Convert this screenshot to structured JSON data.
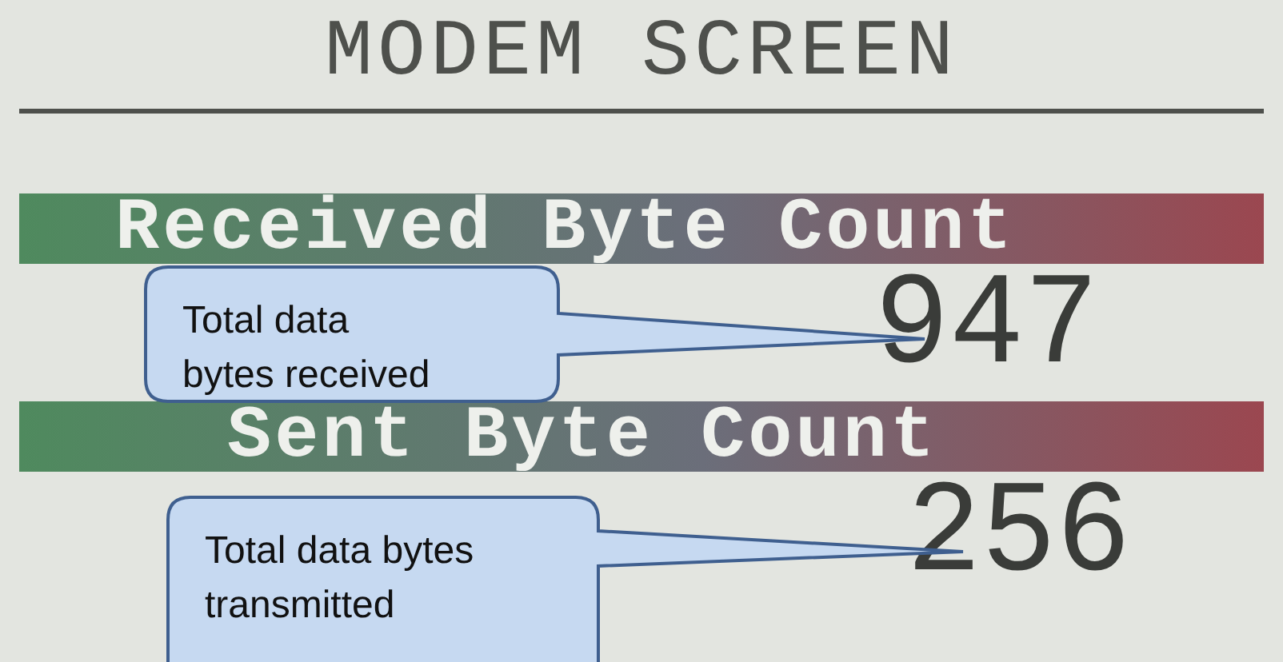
{
  "screen": {
    "title": "MODEM SCREEN"
  },
  "counters": [
    {
      "label": "Received Byte Count",
      "value": "947"
    },
    {
      "label": "Sent Byte Count",
      "value": "256"
    }
  ],
  "callouts": [
    {
      "lines": [
        "Total data",
        "bytes received"
      ]
    },
    {
      "lines": [
        "Total data bytes",
        "transmitted"
      ]
    }
  ]
}
